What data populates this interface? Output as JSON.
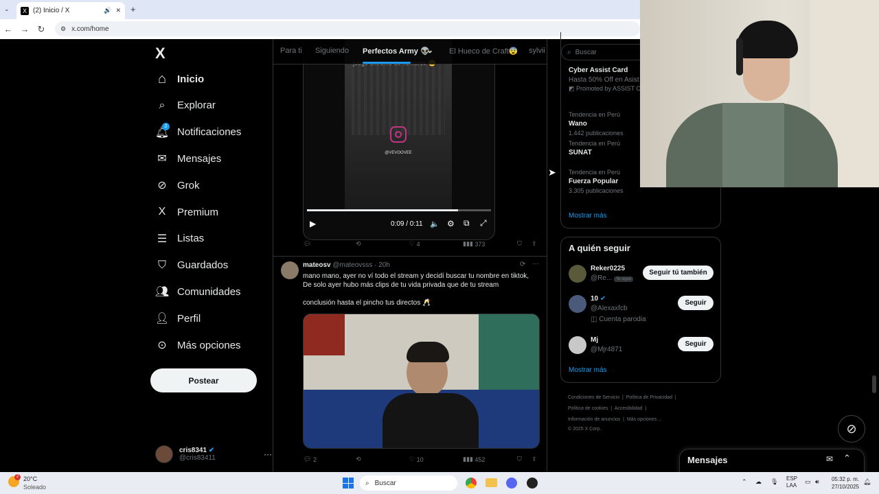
{
  "browser": {
    "tab_title": "(2) Inicio / X",
    "url": "x.com/home"
  },
  "nav": {
    "logo": "X",
    "items": [
      {
        "label": "Inicio",
        "icon": "home-icon"
      },
      {
        "label": "Explorar",
        "icon": "search-icon"
      },
      {
        "label": "Notificaciones",
        "icon": "bell-icon",
        "badge": "2"
      },
      {
        "label": "Mensajes",
        "icon": "mail-icon"
      },
      {
        "label": "Grok",
        "icon": "grok-icon"
      },
      {
        "label": "Premium",
        "icon": "x-icon"
      },
      {
        "label": "Listas",
        "icon": "list-icon"
      },
      {
        "label": "Guardados",
        "icon": "bookmark-icon"
      },
      {
        "label": "Comunidades",
        "icon": "people-icon"
      },
      {
        "label": "Perfil",
        "icon": "person-icon"
      },
      {
        "label": "Más opciones",
        "icon": "more-circle-icon"
      }
    ],
    "post_button": "Postear",
    "account": {
      "name": "cris8341",
      "handle": "@cris83411"
    }
  },
  "topnav": {
    "tabs": [
      "Para ti",
      "Siguiendo",
      "Perfectos Army 👽",
      "El Hueco de Craft😨",
      "sylvii"
    ]
  },
  "video_post": {
    "watermark": "@VEVOOVEE",
    "overlay_text": "juego extremo de nombres 🙂",
    "time": "0:09 / 0:11",
    "progress": 0.82,
    "stats": {
      "likes": "4",
      "views": "373"
    }
  },
  "tweet": {
    "name": "mateosv",
    "handle": "@mateovsss",
    "time": "· 20h",
    "text1": "mano mano, ayer no ví todo el stream y decidí buscar tu nombre en tiktok,",
    "text2": "De solo ayer hubo más clips de tu vida privada que de tu stream",
    "text3": "conclusión hasta el pincho tus directos 🥂",
    "stats": {
      "replies": "2",
      "likes": "10",
      "views": "452"
    }
  },
  "search": {
    "placeholder": "Buscar"
  },
  "trends": {
    "promo": {
      "title": "Cyber Assist Card",
      "desc": "Hasta 50% Off en Asist",
      "promoted": "Promoted by ASSIST CA"
    },
    "items": [
      {
        "context": "Tendencia en Perú",
        "name": "Wano",
        "count": "1.442 publicaciones"
      },
      {
        "context": "Tendencia en Perú",
        "name": "SUNAT",
        "count": ""
      },
      {
        "context": "Tendencia en Perú",
        "name": "Fuerza Popular",
        "count": "3.305 publicaciones"
      }
    ],
    "show_more": "Mostrar más"
  },
  "who_to_follow": {
    "title": "A quién seguir",
    "users": [
      {
        "name": "Reker0225",
        "handle": "@Re...",
        "badge": "Te sigue",
        "button": "Seguir tú también",
        "extra": ""
      },
      {
        "name": "10",
        "handle": "@Alexaxfcb",
        "badge": "",
        "button": "Seguir",
        "extra": "Cuenta parodia"
      },
      {
        "name": "Mj",
        "handle": "@Mjr4871",
        "badge": "",
        "button": "Seguir",
        "extra": ""
      }
    ],
    "show_more": "Mostrar más"
  },
  "footer": {
    "links": [
      "Condiciones de Servicio",
      "Política de Privacidad",
      "Política de cookies",
      "Accesibilidad",
      "Información de anuncios",
      "Más opciones ..."
    ],
    "copyright": "© 2025 X Corp."
  },
  "messages_dock": {
    "title": "Mensajes"
  },
  "taskbar": {
    "temp": "20°C",
    "weather": "Soleado",
    "search": "Buscar",
    "lang1": "ESP",
    "lang2": "LAA",
    "time": "05:32 p. m.",
    "date": "27/10/2025",
    "weather_badge": "2"
  },
  "colors": {
    "accent": "#1d9bf0",
    "bg": "#000000",
    "border": "#2f3336",
    "muted": "#71767b"
  }
}
